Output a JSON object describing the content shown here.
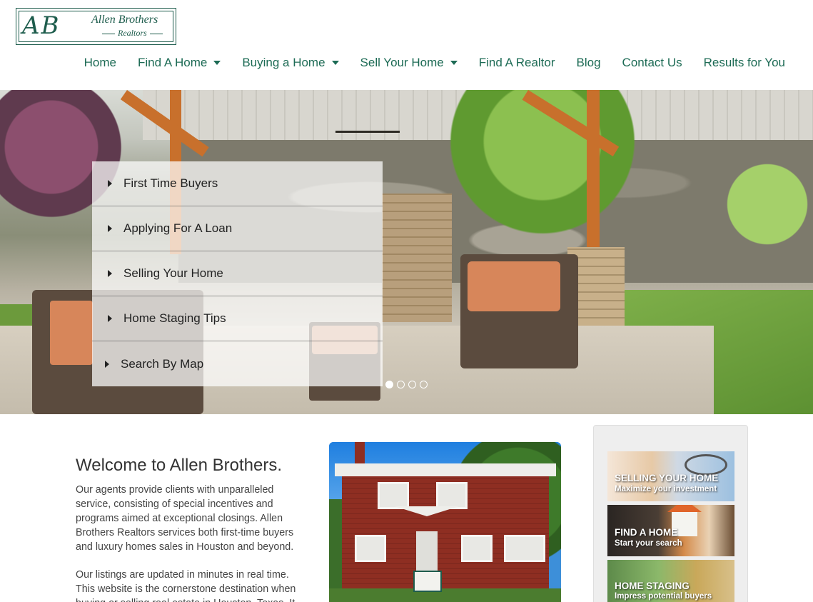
{
  "logo": {
    "monogram": "AB",
    "name": "Allen Brothers",
    "sub": "Realtors"
  },
  "nav": {
    "items": [
      {
        "label": "Home",
        "dropdown": false
      },
      {
        "label": "Find A Home",
        "dropdown": true
      },
      {
        "label": "Buying a Home",
        "dropdown": true
      },
      {
        "label": "Sell Your Home",
        "dropdown": true
      },
      {
        "label": "Find A Realtor",
        "dropdown": false
      },
      {
        "label": "Blog",
        "dropdown": false
      },
      {
        "label": "Contact Us",
        "dropdown": false
      },
      {
        "label": "Results for You",
        "dropdown": false
      }
    ]
  },
  "hero": {
    "menu": [
      {
        "label": "First Time Buyers"
      },
      {
        "label": "Applying For A Loan"
      },
      {
        "label": "Selling Your Home"
      },
      {
        "label": "Home Staging Tips"
      },
      {
        "label": "Search By Map"
      }
    ],
    "slides": 4,
    "active_slide": 1
  },
  "welcome": {
    "title": "Welcome to Allen Brothers.",
    "para1": "Our agents provide clients with unparalleled service, consisting of special incentives and programs aimed at exceptional closings. Allen Brothers Realtors services both first-time buyers and luxury homes sales in Houston and beyond.",
    "para2": "Our listings are updated in minutes in real time. This website is the cornerstone destination when buying or selling real estate in Houston, Texas. It"
  },
  "sidebar": {
    "promos": [
      {
        "title": "SELLING YOUR HOME",
        "sub": "Maximize your investment",
        "icon": "keys-icon"
      },
      {
        "title": "FIND A HOME",
        "sub": "Start your search",
        "icon": "house-icon"
      },
      {
        "title": "HOME STAGING",
        "sub": "Impress potential buyers",
        "icon": "interior-icon"
      }
    ]
  },
  "colors": {
    "brand_green": "#1d6b55",
    "logo_green": "#1d5c4c"
  }
}
